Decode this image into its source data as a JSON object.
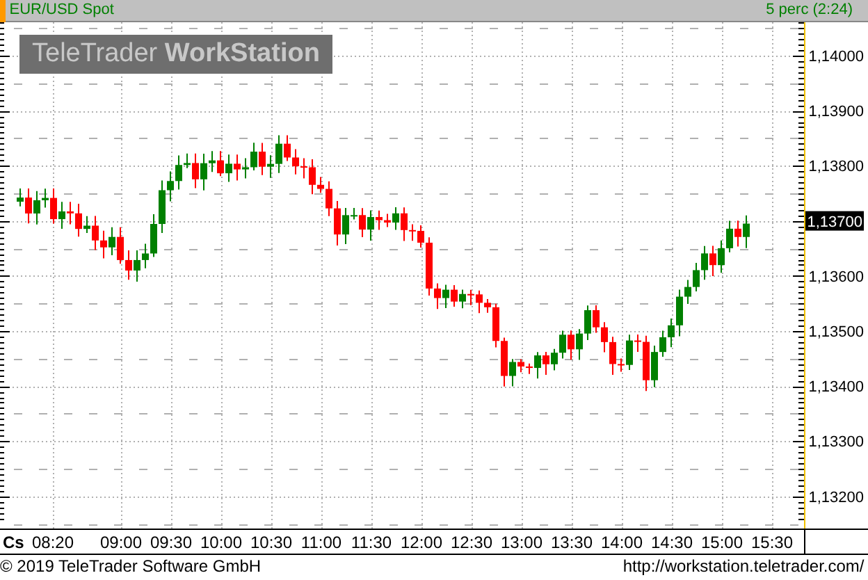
{
  "header": {
    "instrument": "EUR/USD Spot",
    "interval": "5 perc (2:24)"
  },
  "logo": "TeleTrader **WorkStation**",
  "chart": {
    "price_labels": [
      {
        "kind": "scale",
        "text": "1,14000"
      },
      {
        "kind": "scale",
        "text": "1,13900"
      },
      {
        "kind": "scale",
        "text": "1,13800"
      },
      {
        "kind": "current",
        "text": "1,13700"
      },
      {
        "kind": "scale",
        "text": "1,13600"
      },
      {
        "kind": "scale",
        "text": "1,13500"
      },
      {
        "kind": "scale",
        "text": "1,13400"
      },
      {
        "kind": "scale",
        "text": "1,13300"
      },
      {
        "kind": "scale",
        "text": "1,13200"
      }
    ],
    "time_axis_label": "Cs",
    "time_labels": [
      "08:20",
      "09:00",
      "09:30",
      "10:00",
      "10:30",
      "11:00",
      "11:30",
      "12:00",
      "12:30",
      "13:00",
      "13:30",
      "14:00",
      "14:30",
      "15:00",
      "15:30"
    ]
  },
  "footer": {
    "copyright": "© 2019 TeleTrader Software GmbH",
    "url": "http://workstation.teletrader.com/"
  }
}
